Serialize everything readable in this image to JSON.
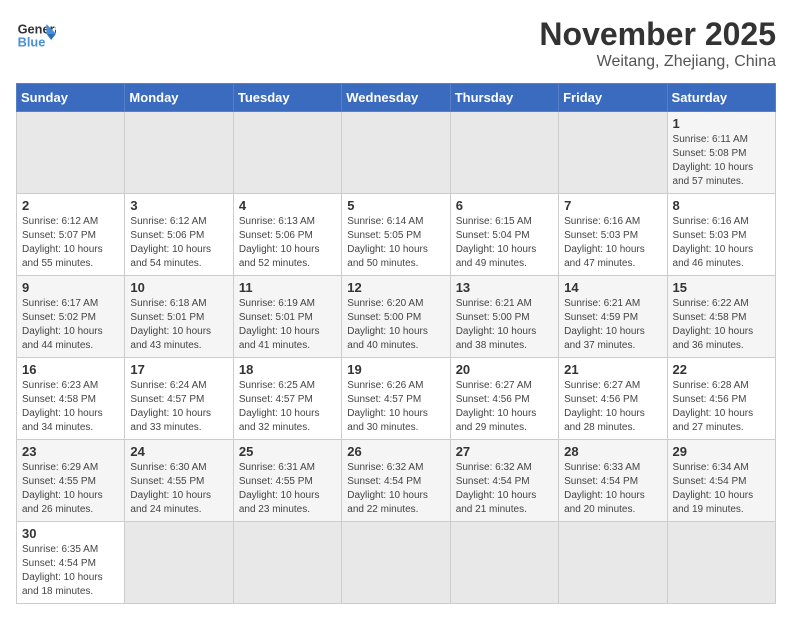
{
  "header": {
    "logo_general": "General",
    "logo_blue": "Blue",
    "month": "November 2025",
    "location": "Weitang, Zhejiang, China"
  },
  "weekdays": [
    "Sunday",
    "Monday",
    "Tuesday",
    "Wednesday",
    "Thursday",
    "Friday",
    "Saturday"
  ],
  "days": {
    "1": {
      "sunrise": "6:11 AM",
      "sunset": "5:08 PM",
      "daylight": "10 hours and 57 minutes."
    },
    "2": {
      "sunrise": "6:12 AM",
      "sunset": "5:07 PM",
      "daylight": "10 hours and 55 minutes."
    },
    "3": {
      "sunrise": "6:12 AM",
      "sunset": "5:06 PM",
      "daylight": "10 hours and 54 minutes."
    },
    "4": {
      "sunrise": "6:13 AM",
      "sunset": "5:06 PM",
      "daylight": "10 hours and 52 minutes."
    },
    "5": {
      "sunrise": "6:14 AM",
      "sunset": "5:05 PM",
      "daylight": "10 hours and 50 minutes."
    },
    "6": {
      "sunrise": "6:15 AM",
      "sunset": "5:04 PM",
      "daylight": "10 hours and 49 minutes."
    },
    "7": {
      "sunrise": "6:16 AM",
      "sunset": "5:03 PM",
      "daylight": "10 hours and 47 minutes."
    },
    "8": {
      "sunrise": "6:16 AM",
      "sunset": "5:03 PM",
      "daylight": "10 hours and 46 minutes."
    },
    "9": {
      "sunrise": "6:17 AM",
      "sunset": "5:02 PM",
      "daylight": "10 hours and 44 minutes."
    },
    "10": {
      "sunrise": "6:18 AM",
      "sunset": "5:01 PM",
      "daylight": "10 hours and 43 minutes."
    },
    "11": {
      "sunrise": "6:19 AM",
      "sunset": "5:01 PM",
      "daylight": "10 hours and 41 minutes."
    },
    "12": {
      "sunrise": "6:20 AM",
      "sunset": "5:00 PM",
      "daylight": "10 hours and 40 minutes."
    },
    "13": {
      "sunrise": "6:21 AM",
      "sunset": "5:00 PM",
      "daylight": "10 hours and 38 minutes."
    },
    "14": {
      "sunrise": "6:21 AM",
      "sunset": "4:59 PM",
      "daylight": "10 hours and 37 minutes."
    },
    "15": {
      "sunrise": "6:22 AM",
      "sunset": "4:58 PM",
      "daylight": "10 hours and 36 minutes."
    },
    "16": {
      "sunrise": "6:23 AM",
      "sunset": "4:58 PM",
      "daylight": "10 hours and 34 minutes."
    },
    "17": {
      "sunrise": "6:24 AM",
      "sunset": "4:57 PM",
      "daylight": "10 hours and 33 minutes."
    },
    "18": {
      "sunrise": "6:25 AM",
      "sunset": "4:57 PM",
      "daylight": "10 hours and 32 minutes."
    },
    "19": {
      "sunrise": "6:26 AM",
      "sunset": "4:57 PM",
      "daylight": "10 hours and 30 minutes."
    },
    "20": {
      "sunrise": "6:27 AM",
      "sunset": "4:56 PM",
      "daylight": "10 hours and 29 minutes."
    },
    "21": {
      "sunrise": "6:27 AM",
      "sunset": "4:56 PM",
      "daylight": "10 hours and 28 minutes."
    },
    "22": {
      "sunrise": "6:28 AM",
      "sunset": "4:56 PM",
      "daylight": "10 hours and 27 minutes."
    },
    "23": {
      "sunrise": "6:29 AM",
      "sunset": "4:55 PM",
      "daylight": "10 hours and 26 minutes."
    },
    "24": {
      "sunrise": "6:30 AM",
      "sunset": "4:55 PM",
      "daylight": "10 hours and 24 minutes."
    },
    "25": {
      "sunrise": "6:31 AM",
      "sunset": "4:55 PM",
      "daylight": "10 hours and 23 minutes."
    },
    "26": {
      "sunrise": "6:32 AM",
      "sunset": "4:54 PM",
      "daylight": "10 hours and 22 minutes."
    },
    "27": {
      "sunrise": "6:32 AM",
      "sunset": "4:54 PM",
      "daylight": "10 hours and 21 minutes."
    },
    "28": {
      "sunrise": "6:33 AM",
      "sunset": "4:54 PM",
      "daylight": "10 hours and 20 minutes."
    },
    "29": {
      "sunrise": "6:34 AM",
      "sunset": "4:54 PM",
      "daylight": "10 hours and 19 minutes."
    },
    "30": {
      "sunrise": "6:35 AM",
      "sunset": "4:54 PM",
      "daylight": "10 hours and 18 minutes."
    }
  }
}
